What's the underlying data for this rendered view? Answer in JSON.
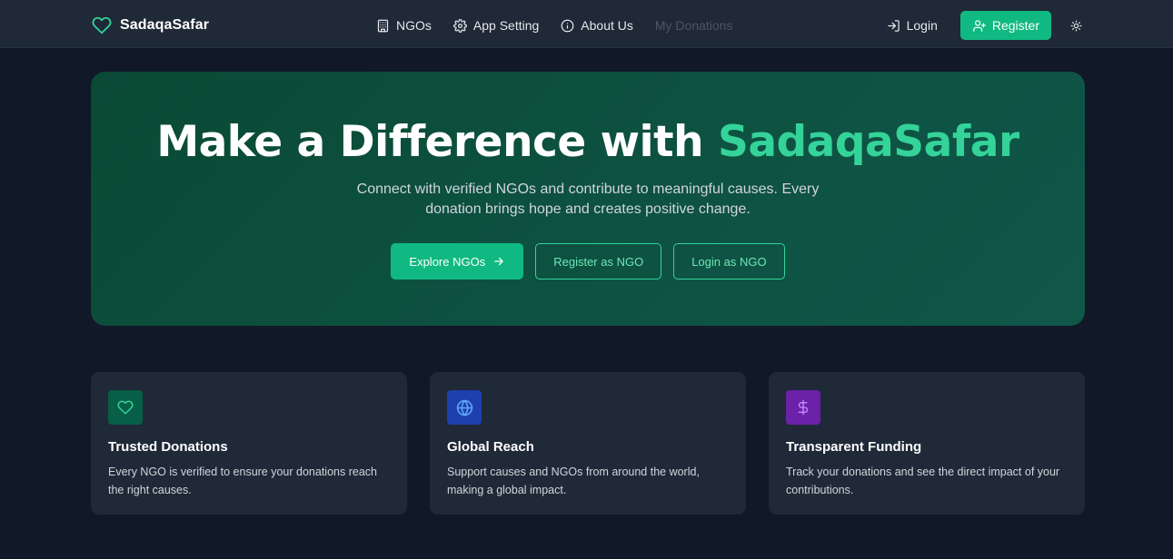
{
  "brand": {
    "name": "SadaqaSafar",
    "icon": "heart-icon",
    "accent": "#34d399"
  },
  "nav": {
    "links": [
      {
        "label": "NGOs",
        "icon": "building-icon"
      },
      {
        "label": "App Setting",
        "icon": "gear-icon"
      },
      {
        "label": "About Us",
        "icon": "info-icon"
      },
      {
        "label": "My Donations",
        "disabled": true
      }
    ],
    "login_label": "Login",
    "register_label": "Register",
    "theme_icon": "sun-icon"
  },
  "hero": {
    "title_prefix": "Make a Difference with",
    "title_accent": "SadaqaSafar",
    "subtitle": "Connect with verified NGOs and contribute to meaningful causes. Every donation brings hope and creates positive change.",
    "buttons": {
      "explore": "Explore NGOs",
      "register_ngo": "Register as NGO",
      "login_ngo": "Login as NGO"
    }
  },
  "features": [
    {
      "title": "Trusted Donations",
      "description": "Every NGO is verified to ensure your donations reach the right causes.",
      "icon": "heart-icon",
      "color": "#065f46"
    },
    {
      "title": "Global Reach",
      "description": "Support causes and NGOs from around the world, making a global impact.",
      "icon": "globe-icon",
      "color": "#1e40af"
    },
    {
      "title": "Transparent Funding",
      "description": "Track your donations and see the direct impact of your contributions.",
      "icon": "dollar-icon",
      "color": "#6b21a8"
    }
  ],
  "colors": {
    "background": "#111827",
    "navbar": "#1f2937",
    "primary": "#10b981",
    "card": "#1f2937"
  }
}
